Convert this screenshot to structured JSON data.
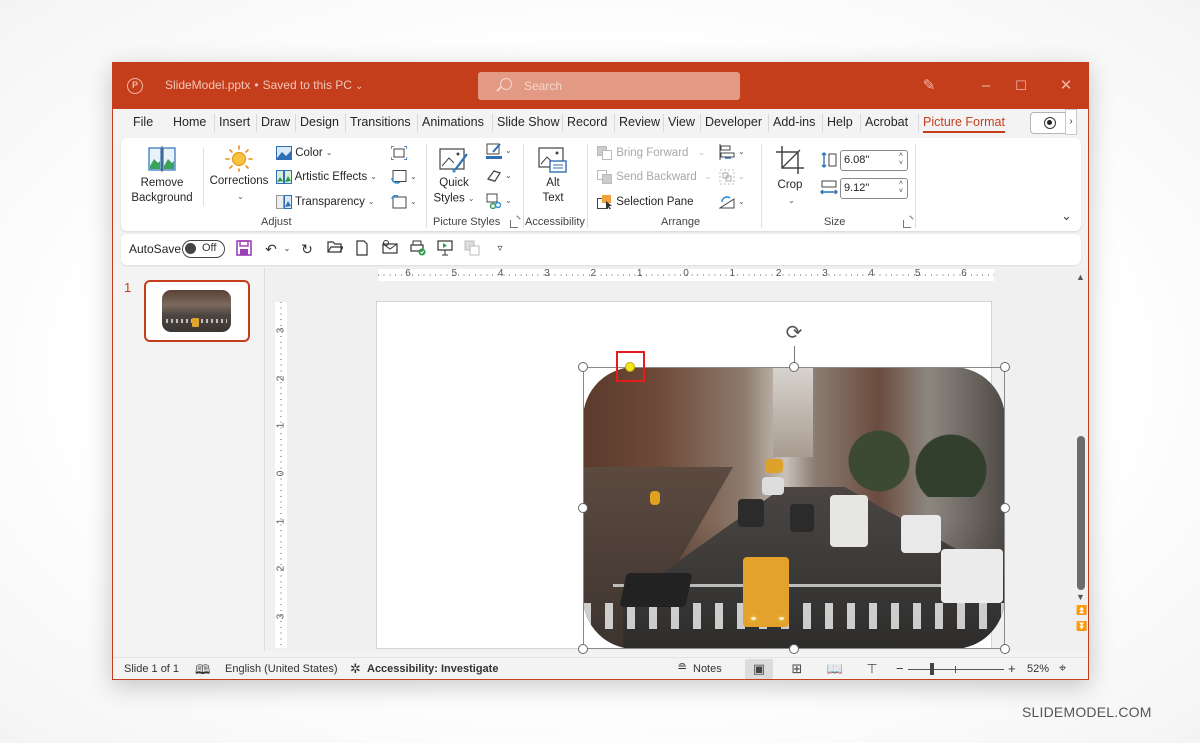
{
  "app": {
    "document_title": "SlideModel.pptx",
    "save_status": "Saved to this PC",
    "search_placeholder": "Search",
    "accent_color": "#c43e1c"
  },
  "title_bar": {
    "icons": [
      "powerpoint-logo-icon",
      "designer-icon",
      "minimize-icon",
      "maximize-icon",
      "close-icon"
    ]
  },
  "tabs": [
    {
      "label": "File"
    },
    {
      "label": "Home"
    },
    {
      "label": "Insert"
    },
    {
      "label": "Draw"
    },
    {
      "label": "Design"
    },
    {
      "label": "Transitions"
    },
    {
      "label": "Animations"
    },
    {
      "label": "Slide Show"
    },
    {
      "label": "Record"
    },
    {
      "label": "Review"
    },
    {
      "label": "View"
    },
    {
      "label": "Developer"
    },
    {
      "label": "Add-ins"
    },
    {
      "label": "Help"
    },
    {
      "label": "Acrobat"
    },
    {
      "label": "Picture Format",
      "active": true
    }
  ],
  "ribbon": {
    "adjust": {
      "group_label": "Adjust",
      "remove_background_line1": "Remove",
      "remove_background_line2": "Background",
      "corrections": "Corrections",
      "color": "Color",
      "artistic_effects": "Artistic Effects",
      "transparency": "Transparency"
    },
    "picture_styles": {
      "group_label": "Picture Styles",
      "quick_styles_line1": "Quick",
      "quick_styles_line2": "Styles"
    },
    "accessibility": {
      "group_label": "Accessibility",
      "alt_text_line1": "Alt",
      "alt_text_line2": "Text"
    },
    "arrange": {
      "group_label": "Arrange",
      "bring_forward": "Bring Forward",
      "send_backward": "Send Backward",
      "selection_pane": "Selection Pane"
    },
    "size": {
      "group_label": "Size",
      "crop": "Crop",
      "height": "6.08\"",
      "width": "9.12\""
    }
  },
  "qat": {
    "autosave_label": "AutoSave",
    "autosave_state": "Off"
  },
  "slide_pane": {
    "slides": [
      {
        "number": "1"
      }
    ]
  },
  "rulers": {
    "horizontal": [
      "6",
      "5",
      "4",
      "3",
      "2",
      "1",
      "0",
      "1",
      "2",
      "3",
      "4",
      "5",
      "6"
    ],
    "vertical": [
      "3",
      "2",
      "1",
      "0",
      "1",
      "2",
      "3"
    ]
  },
  "statusbar": {
    "slide_info": "Slide 1 of 1",
    "language": "English (United States)",
    "accessibility": "Accessibility: Investigate",
    "notes": "Notes",
    "zoom_level": "52%",
    "zoom_minus": "−",
    "zoom_plus": "+"
  },
  "watermark": "SLIDEMODEL.COM"
}
